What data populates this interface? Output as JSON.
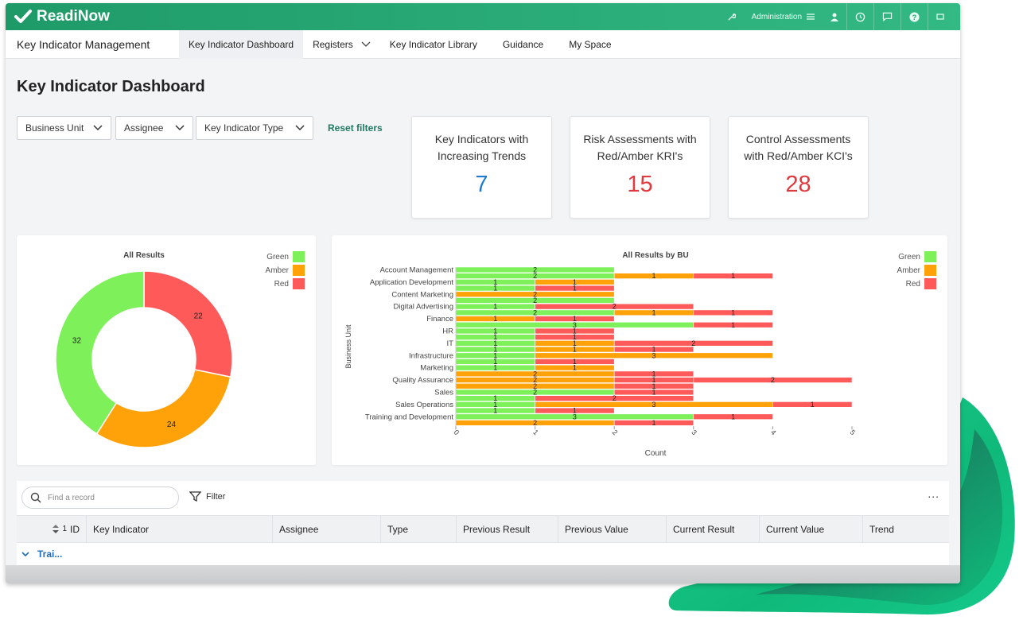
{
  "brand": "ReadiNow",
  "topbar": {
    "admin_label": "Administration"
  },
  "nav": {
    "app_title": "Key Indicator Management",
    "tabs": [
      {
        "label": "Key Indicator Dashboard"
      },
      {
        "label": "Registers"
      },
      {
        "label": "Key Indicator Library"
      },
      {
        "label": "Guidance"
      },
      {
        "label": "My Space"
      }
    ]
  },
  "page": {
    "title": "Key Indicator Dashboard"
  },
  "filters": {
    "business_unit": "Business Unit",
    "assignee": "Assignee",
    "type": "Key Indicator Type",
    "reset": "Reset filters"
  },
  "kpis": [
    {
      "label": "Key Indicators with\nIncreasing Trends",
      "value": "7",
      "color": "#1b7bd3"
    },
    {
      "label": "Risk Assessments with\nRed/Amber KRI's",
      "value": "15",
      "color": "#e0393e"
    },
    {
      "label": "Control Assessments\nwith Red/Amber KCI's",
      "value": "28",
      "color": "#e0393e"
    }
  ],
  "colors": {
    "green": "#7ef05a",
    "amber": "#ffa20a",
    "red": "#ff5a5a"
  },
  "chart_data": [
    {
      "type": "pie",
      "title": "All Results",
      "categories": [
        "Green",
        "Amber",
        "Red"
      ],
      "values": [
        32,
        24,
        22
      ],
      "legend": "top-right"
    },
    {
      "type": "bar",
      "title": "All Results by BU",
      "xlabel": "Count",
      "ylabel": "Business Unit",
      "xlim": [
        0,
        5
      ],
      "xticks": [
        "0",
        "1",
        "2",
        "3",
        "4",
        "5"
      ],
      "legend": "top-right",
      "legend_entries": [
        "Green",
        "Amber",
        "Red"
      ],
      "bu_labels": [
        "Account Management",
        "Application Development",
        "Content Marketing",
        "Digital Advertising",
        "Finance",
        "HR",
        "IT",
        "Infrastructure",
        "Marketing",
        "Quality Assurance",
        "Sales",
        "Sales Operations",
        "Training and Development"
      ],
      "rows": [
        [
          [
            "green",
            2
          ]
        ],
        [
          [
            "green",
            2
          ],
          [
            "amber",
            1
          ],
          [
            "red",
            1
          ]
        ],
        [
          [
            "green",
            1
          ],
          [
            "amber",
            1
          ]
        ],
        [
          [
            "green",
            1
          ],
          [
            "red",
            1
          ]
        ],
        [
          [
            "amber",
            2
          ]
        ],
        [
          [
            "green",
            2
          ]
        ],
        [
          [
            "green",
            1
          ],
          [
            "red",
            2
          ]
        ],
        [
          [
            "green",
            2
          ],
          [
            "amber",
            1
          ],
          [
            "red",
            1
          ]
        ],
        [
          [
            "amber",
            1
          ],
          [
            "red",
            1
          ]
        ],
        [
          [
            "green",
            3
          ],
          [
            "red",
            1
          ]
        ],
        [
          [
            "green",
            1
          ],
          [
            "red",
            1
          ]
        ],
        [
          [
            "green",
            1
          ],
          [
            "red",
            1
          ]
        ],
        [
          [
            "green",
            1
          ],
          [
            "amber",
            1
          ],
          [
            "red",
            2
          ]
        ],
        [
          [
            "green",
            1
          ],
          [
            "amber",
            1
          ],
          [
            "red",
            1
          ]
        ],
        [
          [
            "green",
            1
          ],
          [
            "amber",
            3
          ]
        ],
        [
          [
            "green",
            1
          ],
          [
            "red",
            1
          ]
        ],
        [
          [
            "green",
            1
          ],
          [
            "amber",
            1
          ]
        ],
        [
          [
            "amber",
            2
          ],
          [
            "red",
            1
          ]
        ],
        [
          [
            "amber",
            2
          ],
          [
            "red",
            1
          ],
          [
            "red",
            2
          ]
        ],
        [
          [
            "amber",
            2
          ],
          [
            "red",
            1
          ]
        ],
        [
          [
            "green",
            2
          ],
          [
            "red",
            1
          ]
        ],
        [
          [
            "green",
            1
          ],
          [
            "red",
            2
          ]
        ],
        [
          [
            "green",
            1
          ],
          [
            "amber",
            3
          ],
          [
            "red",
            1
          ]
        ],
        [
          [
            "green",
            1
          ],
          [
            "red",
            1
          ]
        ],
        [
          [
            "green",
            3
          ],
          [
            "red",
            1
          ]
        ],
        [
          [
            "amber",
            2
          ],
          [
            "red",
            1
          ]
        ]
      ]
    }
  ],
  "table": {
    "search_placeholder": "Find a record",
    "filter_label": "Filter",
    "more": "...",
    "sort_indicator": "1",
    "columns": [
      "ID",
      "Key Indicator",
      "Assignee",
      "Type",
      "Previous Result",
      "Previous Value",
      "Current Result",
      "Current Value",
      "Trend"
    ],
    "group_label": "Trai..."
  }
}
